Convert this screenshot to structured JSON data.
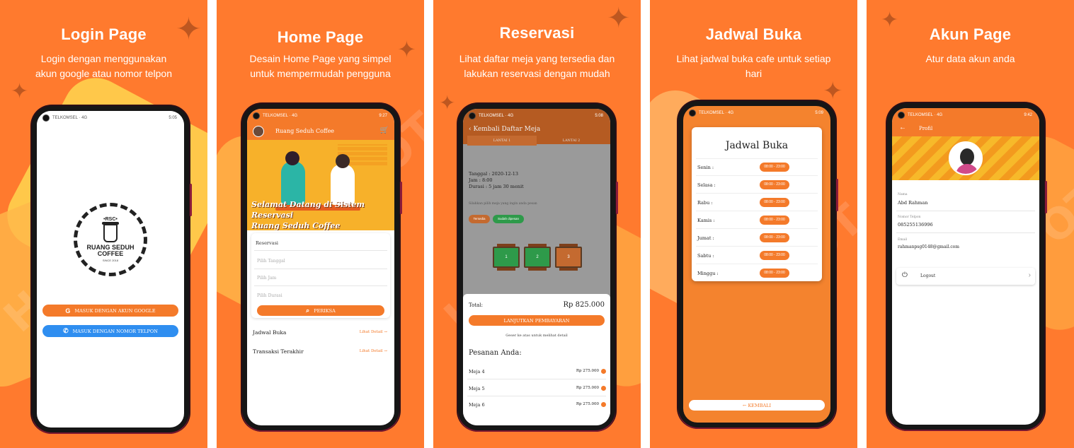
{
  "panels": [
    {
      "title": "Login Page",
      "subtitle_lines": [
        "Login dengan menggunakan",
        "akun google atau nomor telpon"
      ]
    },
    {
      "title": "Home Page",
      "subtitle_lines": [
        "Desain Home Page yang simpel",
        "untuk mempermudah pengguna"
      ]
    },
    {
      "title": "Reservasi",
      "subtitle_lines": [
        "Lihat daftar meja yang tersedia dan",
        "lakukan reservasi dengan mudah"
      ]
    },
    {
      "title": "Jadwal Buka",
      "subtitle_lines": [
        "Lihat jadwal buka cafe untuk setiap",
        "hari"
      ]
    },
    {
      "title": "Akun Page",
      "subtitle_lines": [
        "Atur data akun anda"
      ]
    }
  ],
  "status": {
    "p1_time": "5:05",
    "p2_time": "9:27",
    "p3_time": "5:08",
    "p4_time": "5:09",
    "p5_time": "9:42"
  },
  "login": {
    "logo_top": "•RSC•",
    "logo_name_1": "RUANG SEDUH",
    "logo_name_2": "COFFEE",
    "logo_since": "SINCE 2018",
    "google_button": "MASUK DENGAN AKUN GOOGLE",
    "phone_button": "MASUK DENGAN NOMOR TELPON",
    "google_icon": "G",
    "phone_icon": "✆"
  },
  "home": {
    "app_title": "Ruang Seduh Coffee",
    "cart_icon": "🛒",
    "welcome_1": "Selamat Datang di Sistem Reservasi",
    "welcome_2": "Ruang Seduh Coffee",
    "form_title": "Reservasi",
    "date_placeholder": "Pilih Tanggal",
    "time_placeholder": "Pilih Jam",
    "duration_placeholder": "Pilih Durasi",
    "check_button": "PERIKSA",
    "schedule_row": "Jadwal Buka",
    "schedule_link": "Lihat Detail →",
    "transactions_row": "Transaksi Terakhir",
    "transactions_link": "Lihat Detail →"
  },
  "reservasi": {
    "back": "‹  Kembali   Daftar Meja",
    "tab_1": "LANTAI 1",
    "tab_2": "LANTAI 2",
    "date_line": "Tanggal : 2020-12-13",
    "time_line": "Jam : 8:00",
    "duration_line": "Durasi : 5 jam 30 menit",
    "hint": "Silahkan pilih meja yang ingin anda pesan",
    "chip_selected": "Tersedia",
    "chip_available": "Sudah dipesan",
    "seats": [
      "1",
      "2",
      "3"
    ],
    "total_label": "Total:",
    "total_value": "Rp 825.000",
    "pay_button": "LANJUTKAN PEMBAYARAN",
    "swipe_hint": "Geser ke atas untuk melihat detail",
    "orders_title": "Pesanan Anda:",
    "orders": [
      {
        "name": "Meja 4",
        "price": "Rp 275.000"
      },
      {
        "name": "Meja 5",
        "price": "Rp 275.000"
      },
      {
        "name": "Meja 6",
        "price": "Rp 275.000"
      }
    ]
  },
  "jadwal": {
    "title": "Jadwal Buka",
    "days": [
      {
        "day": "Senin :",
        "time": "08:00 - 23:00"
      },
      {
        "day": "Selasa :",
        "time": "08:00 - 23:00"
      },
      {
        "day": "Rabu :",
        "time": "08:00 - 23:00"
      },
      {
        "day": "Kamis :",
        "time": "08:00 - 23:00"
      },
      {
        "day": "Jumat :",
        "time": "08:00 - 23:00"
      },
      {
        "day": "Sabtu :",
        "time": "08:00 - 23:00"
      },
      {
        "day": "Minggu :",
        "time": "08:00 - 23:00"
      }
    ],
    "back_button": "← KEMBALI"
  },
  "akun": {
    "back_icon": "←",
    "title": "Profil",
    "name_label": "Nama",
    "name_value": "Abd Rahman",
    "phone_label": "Nomor Telpon",
    "phone_value": "085255136996",
    "email_label": "Email",
    "email_value": "rahmanpsg0148@gmail.com",
    "logout_label": "Logout",
    "power_icon": "⏻",
    "chevron": "›"
  },
  "watermark": "HOTPOT",
  "colors": {
    "primary": "#ff7a2e",
    "button_blue": "#2f8ef0",
    "accent_green": "#2e9a4a"
  }
}
